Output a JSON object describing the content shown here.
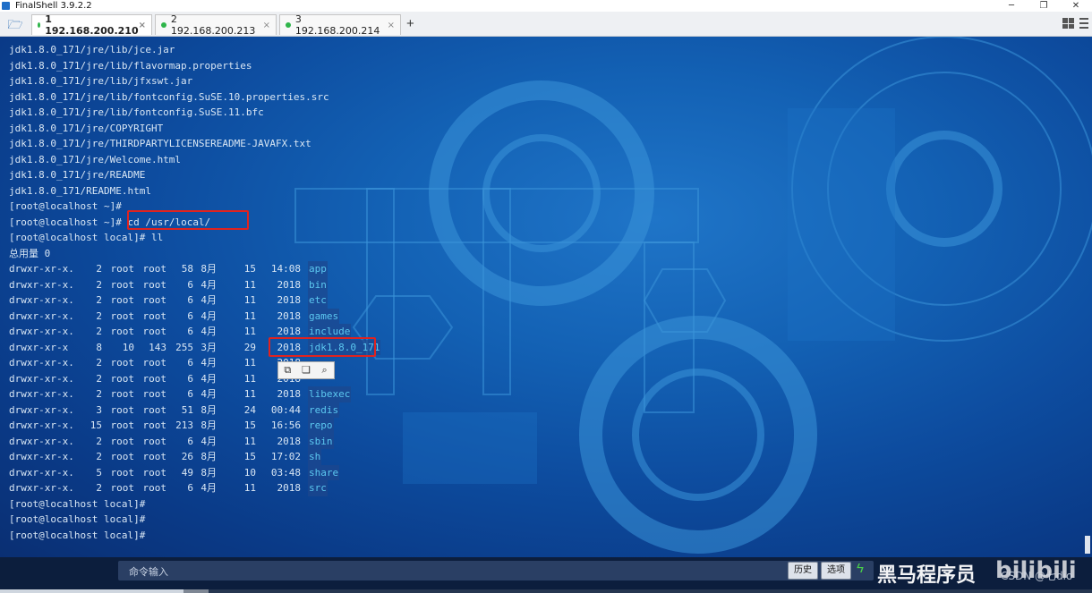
{
  "window": {
    "title": "FinalShell 3.9.2.2",
    "minimize_icon": "minimize-icon",
    "restore_icon": "restore-icon",
    "close_icon": "close-icon"
  },
  "tabs": [
    {
      "label": "1 192.168.200.210",
      "active": true,
      "status_color": "#2fb54a"
    },
    {
      "label": "2 192.168.200.213",
      "active": false,
      "status_color": "#2fb54a"
    },
    {
      "label": "3 192.168.200.214",
      "active": false,
      "status_color": "#2fb54a"
    }
  ],
  "tab_close_glyph": "×",
  "add_tab_glyph": "+",
  "terminal": {
    "path_lines": [
      "jdk1.8.0_171/jre/lib/jce.jar",
      "jdk1.8.0_171/jre/lib/flavormap.properties",
      "jdk1.8.0_171/jre/lib/jfxswt.jar",
      "jdk1.8.0_171/jre/lib/fontconfig.SuSE.10.properties.src",
      "jdk1.8.0_171/jre/lib/fontconfig.SuSE.11.bfc",
      "jdk1.8.0_171/jre/COPYRIGHT",
      "jdk1.8.0_171/jre/THIRDPARTYLICENSEREADME-JAVAFX.txt",
      "jdk1.8.0_171/jre/Welcome.html",
      "jdk1.8.0_171/jre/README",
      "jdk1.8.0_171/README.html"
    ],
    "prompt_home": "[root@localhost ~]#",
    "prompt_cd": "[root@localhost ~]#",
    "cd_command": " cd /usr/local/",
    "prompt_ll": "[root@localhost local]# ll",
    "total_line": "总用量 0",
    "listing": [
      {
        "perm": "drwxr-xr-x.",
        "links": "2",
        "owner": "root",
        "group": "root",
        "size": "58",
        "month": "8月",
        "day": "15",
        "time": "14:08",
        "name": "app"
      },
      {
        "perm": "drwxr-xr-x.",
        "links": "2",
        "owner": "root",
        "group": "root",
        "size": "6",
        "month": "4月",
        "day": "11",
        "time": "2018",
        "name": "bin"
      },
      {
        "perm": "drwxr-xr-x.",
        "links": "2",
        "owner": "root",
        "group": "root",
        "size": "6",
        "month": "4月",
        "day": "11",
        "time": "2018",
        "name": "etc"
      },
      {
        "perm": "drwxr-xr-x.",
        "links": "2",
        "owner": "root",
        "group": "root",
        "size": "6",
        "month": "4月",
        "day": "11",
        "time": "2018",
        "name": "games"
      },
      {
        "perm": "drwxr-xr-x.",
        "links": "2",
        "owner": "root",
        "group": "root",
        "size": "6",
        "month": "4月",
        "day": "11",
        "time": "2018",
        "name": "include"
      },
      {
        "perm": "drwxr-xr-x",
        "links": "8",
        "owner": "10",
        "group": "143",
        "size": "255",
        "month": "3月",
        "day": "29",
        "time": "2018",
        "name": "jdk1.8.0_171"
      },
      {
        "perm": "drwxr-xr-x.",
        "links": "2",
        "owner": "root",
        "group": "root",
        "size": "6",
        "month": "4月",
        "day": "11",
        "time": "2018",
        "name": ""
      },
      {
        "perm": "drwxr-xr-x.",
        "links": "2",
        "owner": "root",
        "group": "root",
        "size": "6",
        "month": "4月",
        "day": "11",
        "time": "2018",
        "name": ""
      },
      {
        "perm": "drwxr-xr-x.",
        "links": "2",
        "owner": "root",
        "group": "root",
        "size": "6",
        "month": "4月",
        "day": "11",
        "time": "2018",
        "name": "libexec"
      },
      {
        "perm": "drwxr-xr-x.",
        "links": "3",
        "owner": "root",
        "group": "root",
        "size": "51",
        "month": "8月",
        "day": "24",
        "time": "00:44",
        "name": "redis"
      },
      {
        "perm": "drwxr-xr-x.",
        "links": "15",
        "owner": "root",
        "group": "root",
        "size": "213",
        "month": "8月",
        "day": "15",
        "time": "16:56",
        "name": "repo"
      },
      {
        "perm": "drwxr-xr-x.",
        "links": "2",
        "owner": "root",
        "group": "root",
        "size": "6",
        "month": "4月",
        "day": "11",
        "time": "2018",
        "name": "sbin"
      },
      {
        "perm": "drwxr-xr-x.",
        "links": "2",
        "owner": "root",
        "group": "root",
        "size": "26",
        "month": "8月",
        "day": "15",
        "time": "17:02",
        "name": "sh"
      },
      {
        "perm": "drwxr-xr-x.",
        "links": "5",
        "owner": "root",
        "group": "root",
        "size": "49",
        "month": "8月",
        "day": "10",
        "time": "03:48",
        "name": "share"
      },
      {
        "perm": "drwxr-xr-x.",
        "links": "2",
        "owner": "root",
        "group": "root",
        "size": "6",
        "month": "4月",
        "day": "11",
        "time": "2018",
        "name": "src"
      }
    ],
    "trailing_prompts": [
      "[root@localhost local]#",
      "[root@localhost local]#",
      "[root@localhost local]#"
    ]
  },
  "popup_toolbar": {
    "copy_icon": "copy-icon",
    "paste_icon": "paste-icon",
    "search_icon": "search-icon"
  },
  "command_bar": {
    "placeholder": "命令输入",
    "history_label": "历史",
    "options_label": "选项",
    "bolt_icon": "lightning-icon"
  },
  "overlays": {
    "watermark": "黑马程序员",
    "csdn": "CSDN @七dio",
    "bili": "bilibili"
  },
  "colors": {
    "highlight": "#e0231f",
    "terminal_text": "#d8e6f4",
    "dir_name": "#5cc8f0",
    "status_dot": "#2fb54a"
  }
}
